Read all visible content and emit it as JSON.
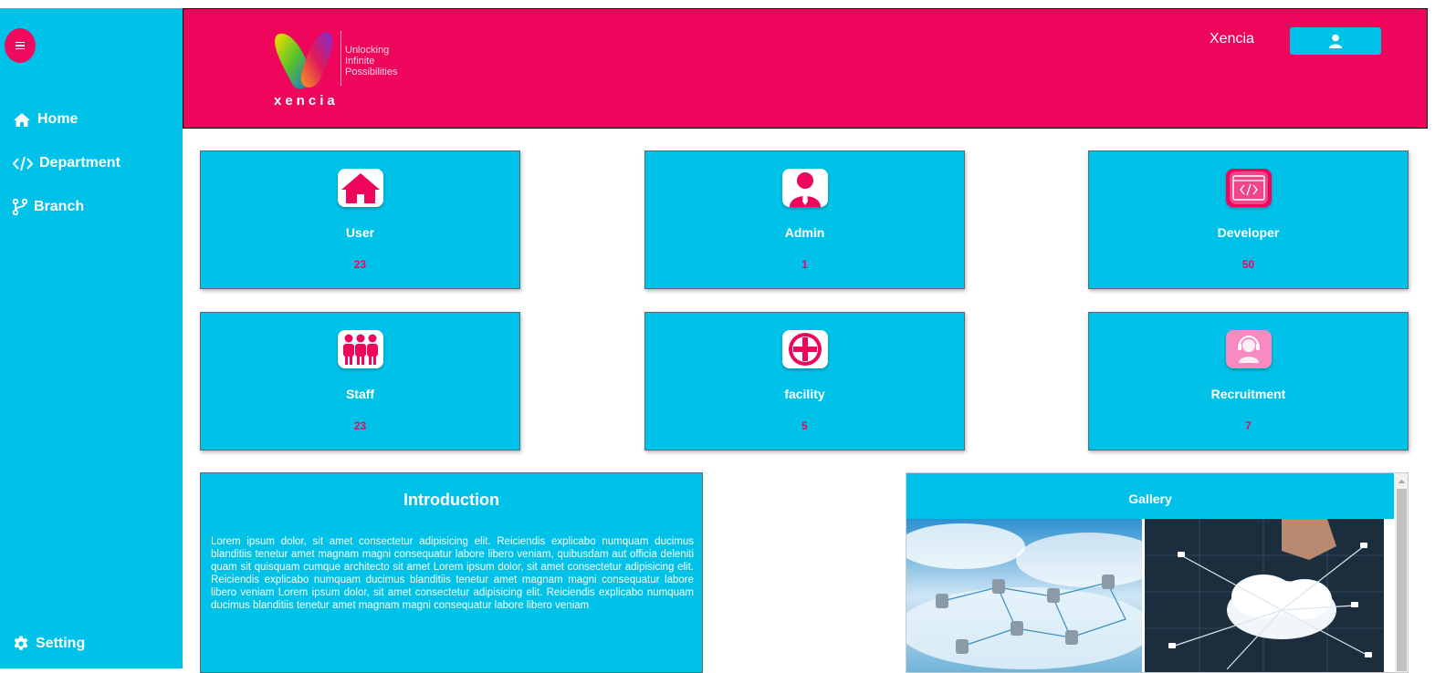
{
  "sidebar": {
    "menu_icon": "hamburger-icon",
    "items": [
      {
        "label": "Home",
        "icon": "home-icon"
      },
      {
        "label": "Department",
        "icon": "code-icon"
      },
      {
        "label": "Branch",
        "icon": "branch-icon"
      }
    ],
    "setting": {
      "label": "Setting",
      "icon": "gear-icon"
    }
  },
  "header": {
    "logo_text": "xencia",
    "tagline": [
      "Unlocking",
      "Infinite",
      "Possibilities"
    ],
    "user_name": "Xencia",
    "user_icon": "user-icon"
  },
  "cards": [
    {
      "label": "User",
      "count": "23",
      "icon": "house-icon"
    },
    {
      "label": "Admin",
      "count": "1",
      "icon": "admin-person-icon"
    },
    {
      "label": "Developer",
      "count": "50",
      "icon": "code-window-icon"
    },
    {
      "label": "Staff",
      "count": "23",
      "icon": "people-group-icon"
    },
    {
      "label": "facility",
      "count": "5",
      "icon": "medical-cross-icon"
    },
    {
      "label": "Recruitment",
      "count": "7",
      "icon": "headset-support-icon"
    }
  ],
  "introduction": {
    "title": "Introduction",
    "text": "Lorem ipsum dolor, sit amet consectetur adipisicing elit. Reiciendis explicabo numquam ducimus blanditiis tenetur amet magnam magni consequatur labore libero veniam, quibusdam aut officia deleniti quam sit quisquam cumque architecto sit amet Lorem ipsum dolor, sit amet consectetur adipisicing elit. Reiciendis explicabo numquam ducimus blanditiis tenetur amet magnam magni consequatur labore libero veniam Lorem ipsum dolor, sit amet consectetur adipisicing elit. Reiciendis explicabo numquam ducimus blanditiis tenetur amet magnam magni consequatur labore libero veniam"
  },
  "gallery": {
    "title": "Gallery",
    "images": [
      "cloud-network-image",
      "cloud-hand-image"
    ]
  },
  "colors": {
    "primary": "#00c2e8",
    "accent": "#ee055c",
    "text_light": "#ffffff"
  }
}
